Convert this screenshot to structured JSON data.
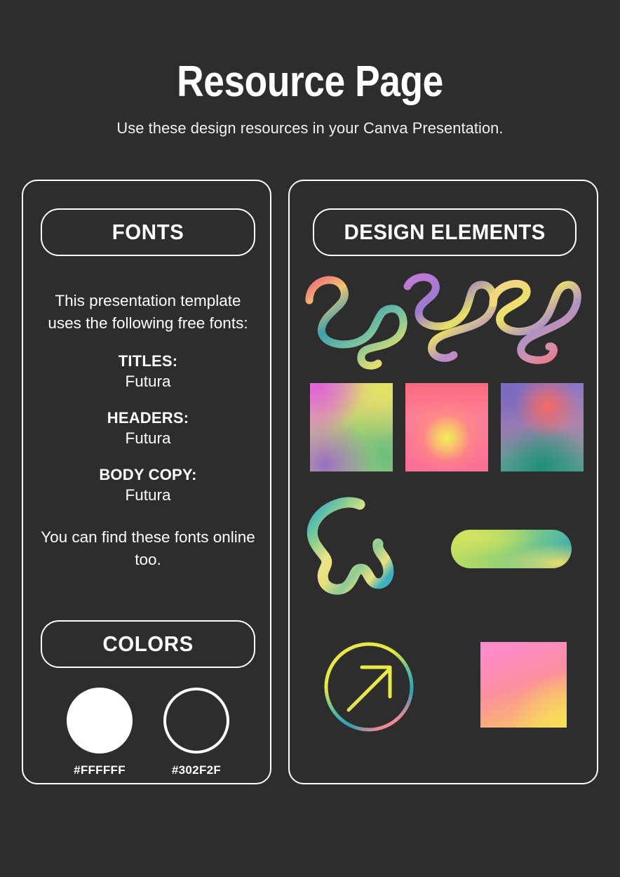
{
  "header": {
    "title": "Resource Page",
    "subtitle": "Use these design resources in your Canva Presentation."
  },
  "left_panel": {
    "fonts_badge": "FONTS",
    "intro": "This presentation template uses the following free fonts:",
    "font_entries": [
      {
        "role": "TITLES:",
        "name": "Futura"
      },
      {
        "role": "HEADERS:",
        "name": "Futura"
      },
      {
        "role": "BODY COPY:",
        "name": "Futura"
      }
    ],
    "outro": "You can find these fonts online too.",
    "colors_badge": "COLORS",
    "swatches": [
      {
        "hex": "#FFFFFF",
        "style": "filled"
      },
      {
        "hex": "#302F2F",
        "style": "outlined"
      }
    ]
  },
  "right_panel": {
    "elements_badge": "DESIGN ELEMENTS",
    "icons": {
      "squiggle_1": "squiggle-line-icon",
      "squiggle_2": "squiggle-line-icon",
      "squiggle_3": "loop-squiggle-icon",
      "square_1": "gradient-square-swatch",
      "square_2": "gradient-square-swatch",
      "square_3": "gradient-square-swatch",
      "blob": "blob-outline-icon",
      "pill": "gradient-pill-shape",
      "arrow": "arrow-up-right-circle-icon",
      "pink_square": "gradient-square-swatch"
    }
  },
  "theme": {
    "background": "#2E2D2D",
    "foreground": "#FFFFFF"
  }
}
